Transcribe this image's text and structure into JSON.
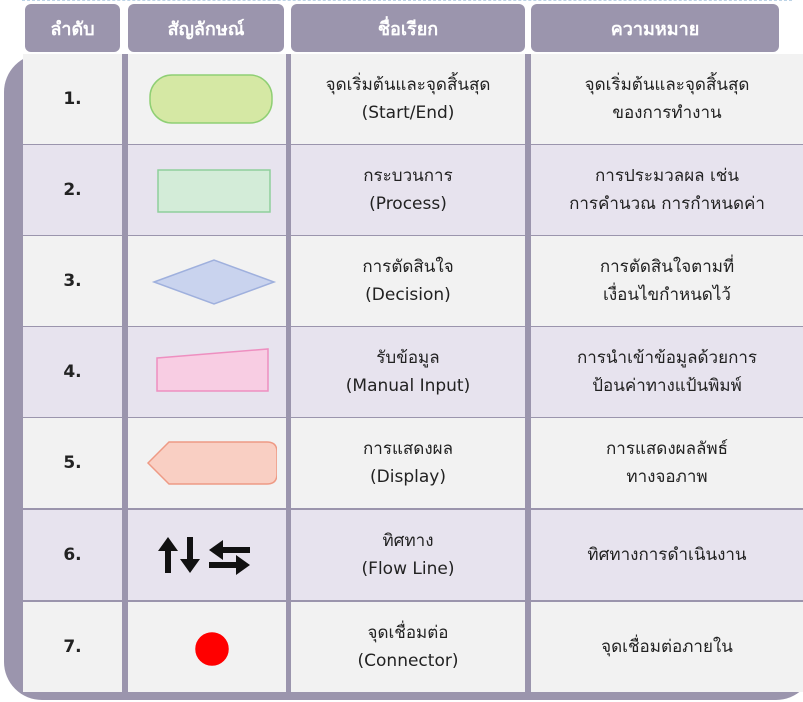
{
  "headers": {
    "order": "ลำดับ",
    "symbol": "สัญลักษณ์",
    "name": "ชื่อเรียก",
    "meaning": "ความหมาย"
  },
  "rows": [
    {
      "num": "1.",
      "symbol_icon": "start-end-terminator-icon",
      "symbol_fill": "#d5e8a4",
      "symbol_stroke": "#8fcf74",
      "name": "จุดเริ่มต้นและจุดสิ้นสุด\n(Start/End)",
      "meaning": "จุดเริ่มต้นและจุดสิ้นสุด\nของการทำงาน"
    },
    {
      "num": "2.",
      "symbol_icon": "process-rectangle-icon",
      "symbol_fill": "#d3ecd8",
      "symbol_stroke": "#8fcf9c",
      "name": "กระบวนการ\n(Process)",
      "meaning": "การประมวลผล เช่น\nการคำนวณ การกำหนดค่า"
    },
    {
      "num": "3.",
      "symbol_icon": "decision-diamond-icon",
      "symbol_fill": "#c9d3ee",
      "symbol_stroke": "#9fb0dd",
      "name": "การตัดสินใจ\n(Decision)",
      "meaning": "การตัดสินใจตามที่\nเงื่อนไขกำหนดไว้"
    },
    {
      "num": "4.",
      "symbol_icon": "manual-input-icon",
      "symbol_fill": "#f8cde3",
      "symbol_stroke": "#ee8fc0",
      "name": "รับข้อมูล\n(Manual Input)",
      "meaning": "การนำเข้าข้อมูลด้วยการ\nป้อนค่าทางแป้นพิมพ์"
    },
    {
      "num": "5.",
      "symbol_icon": "display-icon",
      "symbol_fill": "#f9cfc3",
      "symbol_stroke": "#ee9a85",
      "name": "การแสดงผล\n(Display)",
      "meaning": "การแสดงผลลัพธ์\nทางจอภาพ"
    },
    {
      "num": "6.",
      "symbol_icon": "flow-line-arrows-icon",
      "symbol_fill": "#111111",
      "symbol_stroke": "#111111",
      "name": "ทิศทาง\n(Flow Line)",
      "meaning": "ทิศทางการดำเนินงาน"
    },
    {
      "num": "7.",
      "symbol_icon": "connector-circle-icon",
      "symbol_fill": "#ff0000",
      "symbol_stroke": "#ff0000",
      "name": "จุดเชื่อมต่อ\n(Connector)",
      "meaning": "จุดเชื่อมต่อภายใน"
    }
  ],
  "colors": {
    "frame": "#9b95ad",
    "header_text": "#ffffff",
    "row_light": "#f2f2f2",
    "row_tinted": "#e7e3ee",
    "text": "#222222"
  }
}
